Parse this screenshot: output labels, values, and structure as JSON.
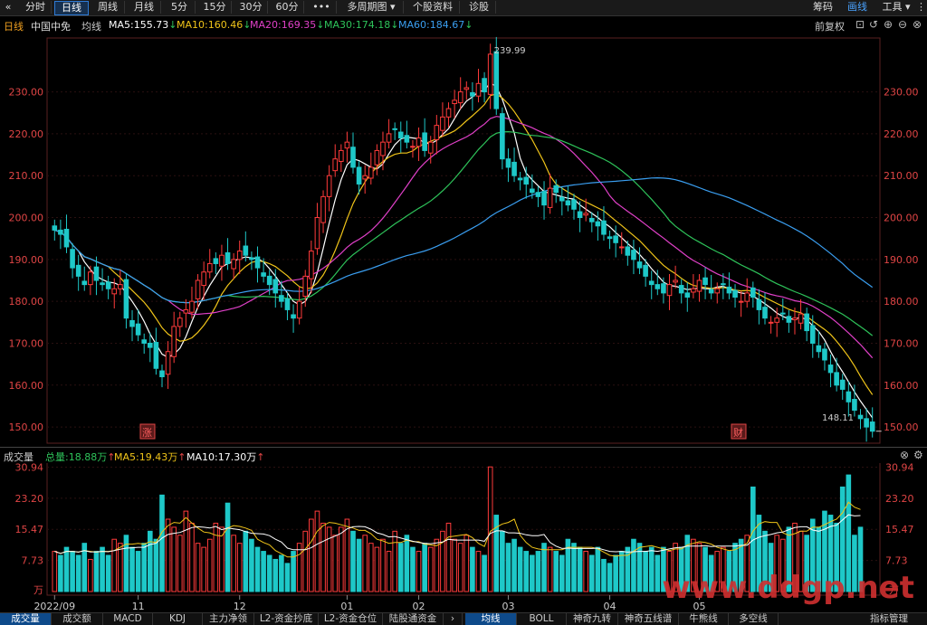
{
  "topbar": {
    "collapse_icon": "«",
    "periods": [
      "分时",
      "日线",
      "周线",
      "月线",
      "5分",
      "15分",
      "30分",
      "60分",
      "•••",
      "多周期图 ▾",
      "个股资料",
      "诊股"
    ],
    "active_period": 1,
    "right_items": [
      "筹码",
      "画线",
      "工具 ▾"
    ]
  },
  "info": {
    "period_label": "日线",
    "stock_name": "中国中免",
    "ma_label": "均线",
    "ma": [
      {
        "label": "MA5:155.73",
        "arrow": "↓",
        "color": "#ffffff"
      },
      {
        "label": "MA10:160.46",
        "arrow": "↓",
        "color": "#f0c419"
      },
      {
        "label": "MA20:169.35",
        "arrow": "↓",
        "color": "#e040c8"
      },
      {
        "label": "MA30:174.18",
        "arrow": "↓",
        "color": "#2ec35a"
      },
      {
        "label": "MA60:184.67",
        "arrow": "↓",
        "color": "#3a9ef0"
      }
    ],
    "adjust": "前复权"
  },
  "chart_data": {
    "type": "candlestick",
    "price_axis": {
      "ticks": [
        "230.00",
        "220.00",
        "210.00",
        "200.00",
        "190.00",
        "180.00",
        "170.00",
        "160.00",
        "150.00"
      ],
      "range": [
        147,
        242
      ]
    },
    "x_labels": [
      "2022/09",
      "11",
      "12",
      "01",
      "02",
      "03",
      "04",
      "05"
    ],
    "high_annotation": "239.99",
    "low_annotation": "148.11",
    "markers": [
      "涨",
      "财"
    ],
    "ma_colors": {
      "ma5": "#ffffff",
      "ma10": "#f0c419",
      "ma20": "#e040c8",
      "ma30": "#2ec35a",
      "ma60": "#3a9ef0"
    },
    "up_color": "#ff3b3b",
    "down_color": "#1ec8c8",
    "close": [
      197,
      196,
      193,
      188,
      186,
      184,
      187,
      185,
      184,
      183,
      183,
      184,
      176,
      174,
      172,
      170,
      169,
      164,
      162,
      168,
      174,
      176,
      178,
      180,
      185,
      187,
      189,
      189,
      191,
      189,
      190,
      192,
      191,
      190,
      188,
      186,
      184,
      182,
      180,
      178,
      176,
      180,
      186,
      192,
      200,
      205,
      210,
      214,
      216,
      218,
      212,
      208,
      210,
      212,
      216,
      218,
      220,
      221,
      219,
      218,
      217,
      219,
      216,
      218,
      222,
      224,
      226,
      228,
      230,
      231,
      229,
      232,
      230,
      239,
      226,
      214,
      212,
      210,
      209,
      208,
      206,
      205,
      203,
      207,
      206,
      204,
      203,
      202,
      200,
      201,
      199,
      198,
      196,
      195,
      194,
      193,
      191,
      190,
      188,
      186,
      184,
      183,
      182,
      184,
      185,
      182,
      181,
      183,
      185,
      184,
      182,
      183,
      184,
      182,
      181,
      180,
      182,
      181,
      178,
      176,
      175,
      176,
      177,
      175,
      176,
      177,
      173,
      170,
      168,
      166,
      163,
      160,
      159,
      156,
      154,
      152,
      150,
      149
    ],
    "volume_axis": {
      "ticks": [
        "30.94",
        "23.20",
        "15.47",
        "7.73"
      ],
      "unit": "万",
      "range": [
        0,
        31.5
      ]
    },
    "volume": [
      10,
      9,
      11,
      10,
      9,
      12,
      8,
      10,
      11,
      9,
      13,
      12,
      14,
      11,
      10,
      12,
      15,
      13,
      24,
      18,
      16,
      14,
      20,
      17,
      12,
      11,
      13,
      17,
      16,
      22,
      14,
      12,
      15,
      13,
      11,
      10,
      9,
      8,
      9,
      7,
      10,
      12,
      15,
      18,
      20,
      17,
      16,
      14,
      16,
      18,
      15,
      13,
      14,
      12,
      11,
      13,
      10,
      15,
      12,
      14,
      11,
      10,
      12,
      11,
      13,
      15,
      17,
      13,
      12,
      14,
      11,
      10,
      9,
      31,
      19,
      15,
      12,
      13,
      11,
      10,
      9,
      10,
      12,
      11,
      10,
      9,
      13,
      12,
      11,
      10,
      9,
      11,
      8,
      7,
      9,
      10,
      11,
      13,
      12,
      10,
      11,
      9,
      11,
      10,
      12,
      11,
      14,
      13,
      12,
      11,
      9,
      10,
      11,
      10,
      12,
      13,
      14,
      26,
      19,
      15,
      12,
      14,
      13,
      16,
      17,
      15,
      14,
      18,
      16,
      20,
      19,
      17,
      26,
      29,
      14,
      16
    ]
  },
  "volbar": {
    "title": "成交量",
    "total": "总量:18.88万",
    "total_arrow": "↑",
    "ma5": "MA5:19.43万",
    "ma5_arrow": "↑",
    "ma10": "MA10:17.30万",
    "ma10_arrow": "↑"
  },
  "bottom_tabs": {
    "left": [
      "成交量",
      "成交额",
      "MACD",
      "KDJ",
      "主力净领",
      "L2-资金抄底",
      "L2-资金仓位",
      "陆股通资金"
    ],
    "left_active": 0,
    "right": [
      "均线",
      "BOLL",
      "神奇九转",
      "神奇五线谱",
      "牛熊线",
      "多空线"
    ],
    "right_active": 0,
    "manage": "指标管理"
  },
  "watermark": "www.ddgp.net"
}
